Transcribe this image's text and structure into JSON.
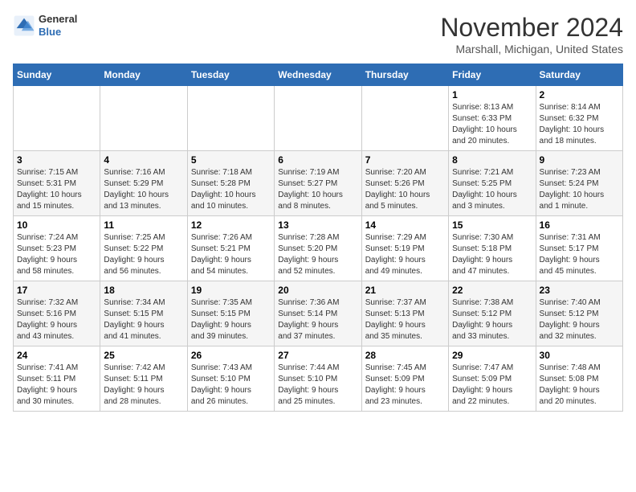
{
  "header": {
    "logo_line1": "General",
    "logo_line2": "Blue",
    "month": "November 2024",
    "location": "Marshall, Michigan, United States"
  },
  "days_of_week": [
    "Sunday",
    "Monday",
    "Tuesday",
    "Wednesday",
    "Thursday",
    "Friday",
    "Saturday"
  ],
  "weeks": [
    [
      {
        "day": "",
        "info": ""
      },
      {
        "day": "",
        "info": ""
      },
      {
        "day": "",
        "info": ""
      },
      {
        "day": "",
        "info": ""
      },
      {
        "day": "",
        "info": ""
      },
      {
        "day": "1",
        "info": "Sunrise: 8:13 AM\nSunset: 6:33 PM\nDaylight: 10 hours\nand 20 minutes."
      },
      {
        "day": "2",
        "info": "Sunrise: 8:14 AM\nSunset: 6:32 PM\nDaylight: 10 hours\nand 18 minutes."
      }
    ],
    [
      {
        "day": "3",
        "info": "Sunrise: 7:15 AM\nSunset: 5:31 PM\nDaylight: 10 hours\nand 15 minutes."
      },
      {
        "day": "4",
        "info": "Sunrise: 7:16 AM\nSunset: 5:29 PM\nDaylight: 10 hours\nand 13 minutes."
      },
      {
        "day": "5",
        "info": "Sunrise: 7:18 AM\nSunset: 5:28 PM\nDaylight: 10 hours\nand 10 minutes."
      },
      {
        "day": "6",
        "info": "Sunrise: 7:19 AM\nSunset: 5:27 PM\nDaylight: 10 hours\nand 8 minutes."
      },
      {
        "day": "7",
        "info": "Sunrise: 7:20 AM\nSunset: 5:26 PM\nDaylight: 10 hours\nand 5 minutes."
      },
      {
        "day": "8",
        "info": "Sunrise: 7:21 AM\nSunset: 5:25 PM\nDaylight: 10 hours\nand 3 minutes."
      },
      {
        "day": "9",
        "info": "Sunrise: 7:23 AM\nSunset: 5:24 PM\nDaylight: 10 hours\nand 1 minute."
      }
    ],
    [
      {
        "day": "10",
        "info": "Sunrise: 7:24 AM\nSunset: 5:23 PM\nDaylight: 9 hours\nand 58 minutes."
      },
      {
        "day": "11",
        "info": "Sunrise: 7:25 AM\nSunset: 5:22 PM\nDaylight: 9 hours\nand 56 minutes."
      },
      {
        "day": "12",
        "info": "Sunrise: 7:26 AM\nSunset: 5:21 PM\nDaylight: 9 hours\nand 54 minutes."
      },
      {
        "day": "13",
        "info": "Sunrise: 7:28 AM\nSunset: 5:20 PM\nDaylight: 9 hours\nand 52 minutes."
      },
      {
        "day": "14",
        "info": "Sunrise: 7:29 AM\nSunset: 5:19 PM\nDaylight: 9 hours\nand 49 minutes."
      },
      {
        "day": "15",
        "info": "Sunrise: 7:30 AM\nSunset: 5:18 PM\nDaylight: 9 hours\nand 47 minutes."
      },
      {
        "day": "16",
        "info": "Sunrise: 7:31 AM\nSunset: 5:17 PM\nDaylight: 9 hours\nand 45 minutes."
      }
    ],
    [
      {
        "day": "17",
        "info": "Sunrise: 7:32 AM\nSunset: 5:16 PM\nDaylight: 9 hours\nand 43 minutes."
      },
      {
        "day": "18",
        "info": "Sunrise: 7:34 AM\nSunset: 5:15 PM\nDaylight: 9 hours\nand 41 minutes."
      },
      {
        "day": "19",
        "info": "Sunrise: 7:35 AM\nSunset: 5:15 PM\nDaylight: 9 hours\nand 39 minutes."
      },
      {
        "day": "20",
        "info": "Sunrise: 7:36 AM\nSunset: 5:14 PM\nDaylight: 9 hours\nand 37 minutes."
      },
      {
        "day": "21",
        "info": "Sunrise: 7:37 AM\nSunset: 5:13 PM\nDaylight: 9 hours\nand 35 minutes."
      },
      {
        "day": "22",
        "info": "Sunrise: 7:38 AM\nSunset: 5:12 PM\nDaylight: 9 hours\nand 33 minutes."
      },
      {
        "day": "23",
        "info": "Sunrise: 7:40 AM\nSunset: 5:12 PM\nDaylight: 9 hours\nand 32 minutes."
      }
    ],
    [
      {
        "day": "24",
        "info": "Sunrise: 7:41 AM\nSunset: 5:11 PM\nDaylight: 9 hours\nand 30 minutes."
      },
      {
        "day": "25",
        "info": "Sunrise: 7:42 AM\nSunset: 5:11 PM\nDaylight: 9 hours\nand 28 minutes."
      },
      {
        "day": "26",
        "info": "Sunrise: 7:43 AM\nSunset: 5:10 PM\nDaylight: 9 hours\nand 26 minutes."
      },
      {
        "day": "27",
        "info": "Sunrise: 7:44 AM\nSunset: 5:10 PM\nDaylight: 9 hours\nand 25 minutes."
      },
      {
        "day": "28",
        "info": "Sunrise: 7:45 AM\nSunset: 5:09 PM\nDaylight: 9 hours\nand 23 minutes."
      },
      {
        "day": "29",
        "info": "Sunrise: 7:47 AM\nSunset: 5:09 PM\nDaylight: 9 hours\nand 22 minutes."
      },
      {
        "day": "30",
        "info": "Sunrise: 7:48 AM\nSunset: 5:08 PM\nDaylight: 9 hours\nand 20 minutes."
      }
    ]
  ]
}
